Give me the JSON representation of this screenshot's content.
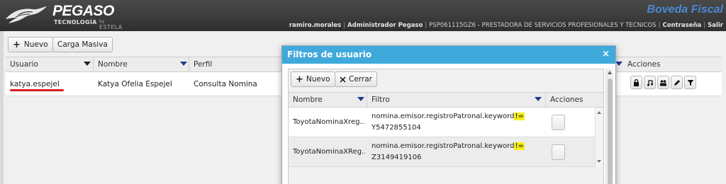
{
  "header": {
    "logo_main": "PEGASO",
    "logo_sub": "TECNOLOGÍA",
    "logo_by": "by",
    "logo_estela": "ESTELA",
    "brand": "Boveda Fiscal",
    "user": "ramiro.morales",
    "role": "Administrador Pegaso",
    "company": "PSP061115GZ6 - PRESTADORA DE SERVICIOS PROFESIONALES Y TECNICOS",
    "password_link": "Contraseña",
    "logout_link": "Salir",
    "separator": "|"
  },
  "toolbar": {
    "nuevo_label": "Nuevo",
    "carga_masiva_label": "Carga Masiva"
  },
  "grid": {
    "columns": [
      "Usuario",
      "Nombre",
      "Perfil",
      "Acciones"
    ],
    "rows": [
      {
        "usuario": "katya.espejel",
        "nombre": "Katya Ofelia Espejel",
        "perfil": "Consulta Nomina"
      }
    ],
    "action_icons": [
      "lock-icon",
      "music-note-icon",
      "users-icon",
      "pencil-icon",
      "filter-icon"
    ]
  },
  "modal": {
    "title": "Filtros de usuario",
    "close_glyph": "×",
    "nuevo_label": "Nuevo",
    "cerrar_label": "Cerrar",
    "columns": [
      "Nombre",
      "Filtro",
      "Acciones"
    ],
    "rows": [
      {
        "nombre": "ToyotaNominaXreg...",
        "filtro_field": "nomina.emisor.registroPatronal.keyword",
        "operator": "!=",
        "value": "Y5472855104"
      },
      {
        "nombre": "ToyotaNominaXReg...",
        "filtro_field": "nomina.emisor.registroPatronal.keyword",
        "operator": "!=",
        "value": "Z3149419106"
      }
    ]
  },
  "colors": {
    "header_bg": "#3a3a3a",
    "brand_blue": "#4a8ad0",
    "modal_title_bg": "#3fa9dc",
    "highlight": "#f4ee1b",
    "underline_red": "#d81e1e",
    "filter_blue": "#1f3c8a"
  }
}
